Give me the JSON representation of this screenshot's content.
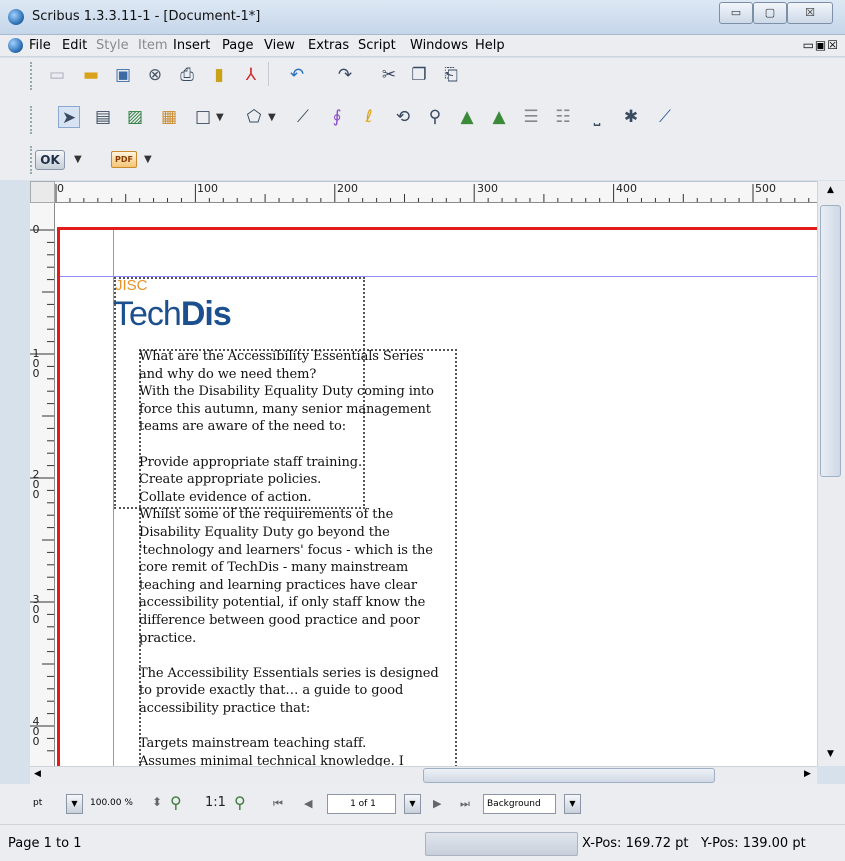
{
  "window": {
    "title": "Scribus 1.3.3.11-1 - [Document-1*]",
    "minimize": "▭",
    "maximize": "▢",
    "close": "☒"
  },
  "menu": {
    "items": [
      "File",
      "Edit",
      "Style",
      "Item",
      "Insert",
      "Page",
      "View",
      "Extras",
      "Script",
      "Windows",
      "Help"
    ],
    "disabled": [
      "Style",
      "Item"
    ],
    "mdi_controls": "▭▣☒"
  },
  "toolbar": {
    "ok_label": "OK",
    "pdf_label": "PDF"
  },
  "rulers": {
    "horizontal": [
      "0",
      "100",
      "200",
      "300",
      "400",
      "500"
    ],
    "vertical": [
      "0",
      "100",
      "200",
      "300",
      "400"
    ]
  },
  "document": {
    "logo_top": "JISC",
    "logo_main_a": "Tech",
    "logo_main_b": "Dis",
    "text": "What are the Accessibility Essentials Series\nand why do we need them?\nWith the Disability Equality Duty coming into\nforce this autumn, many senior management\nteams are aware of the need to:\n\nProvide appropriate staff training.\nCreate appropriate policies.\nCollate evidence of action.\nWhilst some of the requirements of the\nDisability Equality Duty go beyond the\n'technology and learners' focus - which is the\ncore remit of TechDis - many mainstream\nteaching and learning practices have clear\naccessibility potential, if only staff know the\ndifference between good practice and poor\npractice.\n\nThe Accessibility Essentials series is designed\nto provide exactly that… a guide to good\naccessibility practice that:\n\nTargets mainstream teaching staff.\nAssumes minimal technical knowledge. I"
  },
  "navigation": {
    "unit": "pt",
    "zoom": "100.00 %",
    "zoom_ratio": "1:1",
    "page": "1 of 1",
    "layer": "Background"
  },
  "status": {
    "text": "Page 1 to 1",
    "xpos": "X-Pos: 169.72 pt",
    "ypos": "Y-Pos: 139.00 pt"
  }
}
